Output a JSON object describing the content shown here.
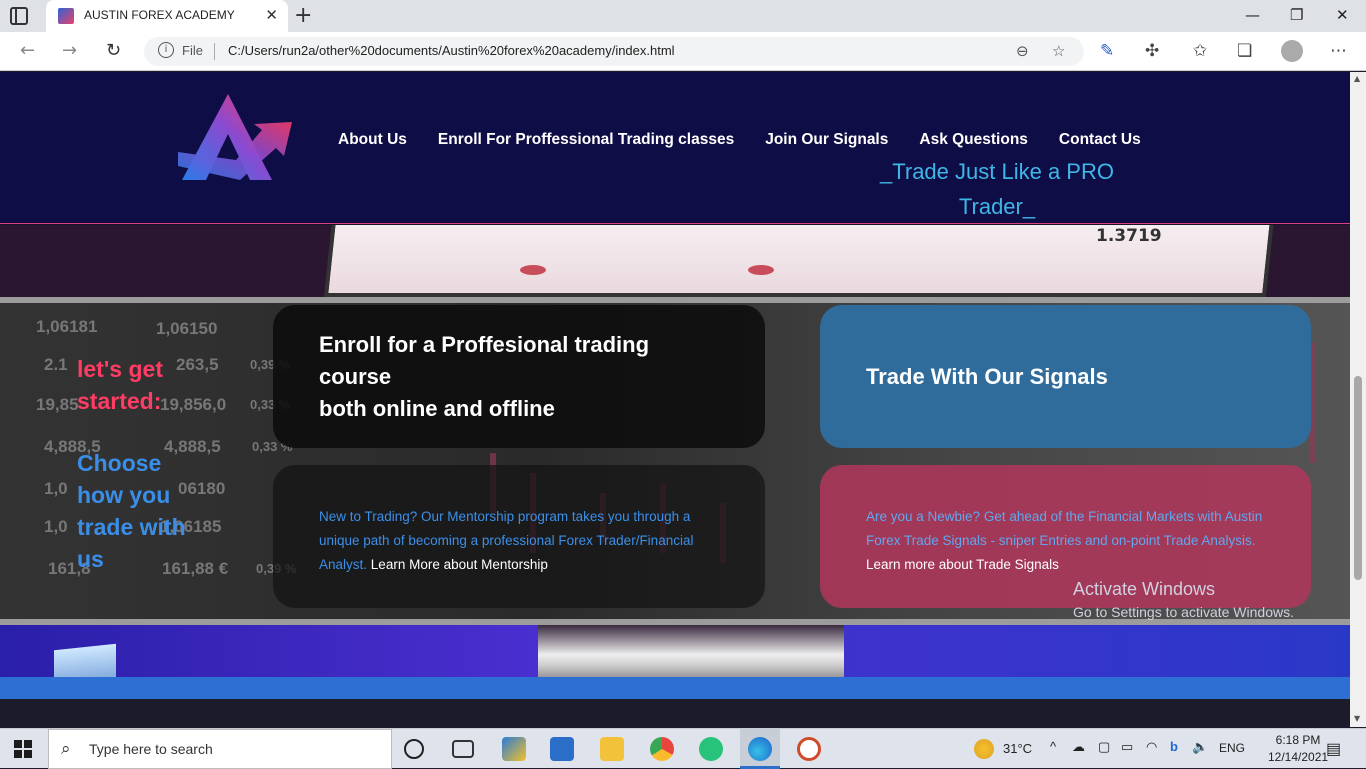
{
  "browser": {
    "tab_title": "AUSTIN FOREX ACADEMY",
    "new_tab_glyph": "+",
    "close_glyph": "✕",
    "url_scheme_label": "File",
    "url": "C:/Users/run2a/other%20documents/Austin%20forex%20academy/index.html",
    "window_controls": [
      "—",
      "❐",
      "✕"
    ]
  },
  "site": {
    "nav": [
      "About Us",
      "Enroll For Proffessional Trading classes",
      "Join Our Signals",
      "Ask Questions",
      "Contact Us"
    ],
    "tagline_line1": "_Trade Just Like a PRO",
    "tagline_line2": "Trader_",
    "hero_price": "1.3719",
    "intro_line1": "let's get",
    "intro_line2": "started:",
    "choose": "Choose how you trade with us",
    "cards": {
      "enroll_title_line1": "Enroll for a Proffesional trading",
      "enroll_title_line2": "course",
      "enroll_title_line3": "both online and offline",
      "signals_title": "Trade With Our Signals",
      "mentor_body": "New to Trading? Our Mentorship program takes you through a unique path of becoming a professional Forex Trader/Financial Analyst.",
      "mentor_link": "Learn More about Mentorship",
      "newbie_body": "Are you a Newbie? Get ahead of the Financial Markets with Austin Forex Trade Signals - sniper Entries and on-point Trade Analysis.",
      "newbie_link": "Learn more about Trade Signals"
    },
    "bg_numbers": [
      "1,06181",
      "1,06150",
      "2.1",
      "263,5",
      "0,39 %",
      "19,85",
      "19,856,0",
      "0,33 %",
      "4,888,5",
      "4,888,5",
      "0,33 %",
      "1,0",
      "06180",
      "1,0",
      "1,06185",
      "161,8",
      "161,88 €",
      "0,39 %"
    ]
  },
  "watermark": {
    "line1": "Activate Windows",
    "line2": "Go to Settings to activate Windows."
  },
  "taskbar": {
    "search_placeholder": "Type here to search",
    "weather": "31°C",
    "lang": "ENG",
    "time": "6:18 PM",
    "date": "12/14/2021"
  },
  "colors": {
    "header_bg": "#0f0d45",
    "accent_pink": "#ff3c64",
    "accent_blue": "#3b8ee8",
    "signals_card": "#2f6c9c",
    "newbie_card": "#af375a"
  }
}
